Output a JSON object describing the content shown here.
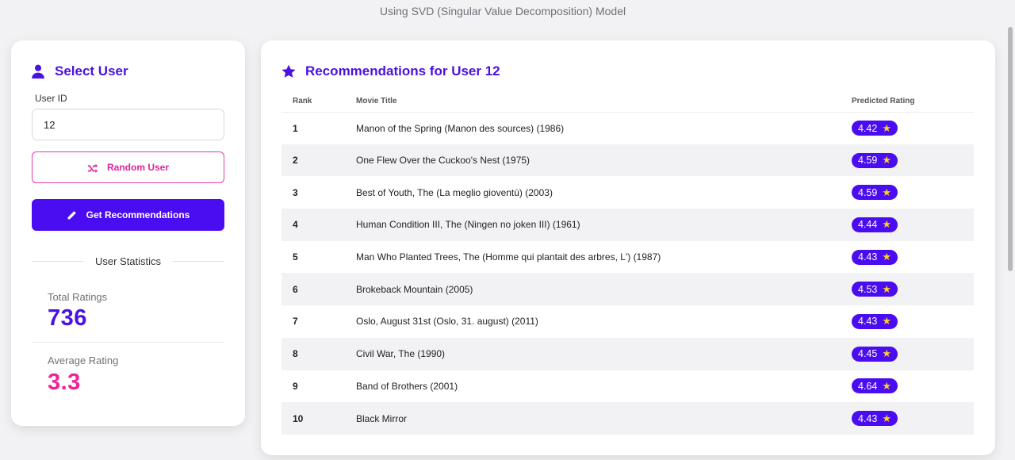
{
  "header": {
    "subtitle": "Using SVD (Singular Value Decomposition) Model"
  },
  "colors": {
    "primary": "#4a12e0",
    "accent_pink": "#f0229a",
    "star": "#ffd21a"
  },
  "left": {
    "title": "Select User",
    "title_icon": "user-icon",
    "user_id_label": "User ID",
    "user_id_value": "12",
    "random_button": "Random User",
    "random_icon": "shuffle-icon",
    "get_button": "Get Recommendations",
    "get_icon": "pencil-icon",
    "stats_heading": "User Statistics",
    "stats": {
      "total_label": "Total Ratings",
      "total_value": "736",
      "avg_label": "Average Rating",
      "avg_value": "3.3"
    }
  },
  "right": {
    "title": "Recommendations for User 12",
    "title_icon": "star-icon",
    "columns": [
      "Rank",
      "Movie Title",
      "Predicted Rating"
    ],
    "rows": [
      {
        "rank": "1",
        "title": "Manon of the Spring (Manon des sources) (1986)",
        "rating": "4.42"
      },
      {
        "rank": "2",
        "title": "One Flew Over the Cuckoo's Nest (1975)",
        "rating": "4.59"
      },
      {
        "rank": "3",
        "title": "Best of Youth, The (La meglio gioventù) (2003)",
        "rating": "4.59"
      },
      {
        "rank": "4",
        "title": "Human Condition III, The (Ningen no joken III) (1961)",
        "rating": "4.44"
      },
      {
        "rank": "5",
        "title": "Man Who Planted Trees, The (Homme qui plantait des arbres, L') (1987)",
        "rating": "4.43"
      },
      {
        "rank": "6",
        "title": "Brokeback Mountain (2005)",
        "rating": "4.53"
      },
      {
        "rank": "7",
        "title": "Oslo, August 31st (Oslo, 31. august) (2011)",
        "rating": "4.43"
      },
      {
        "rank": "8",
        "title": "Civil War, The (1990)",
        "rating": "4.45"
      },
      {
        "rank": "9",
        "title": "Band of Brothers (2001)",
        "rating": "4.64"
      },
      {
        "rank": "10",
        "title": "Black Mirror",
        "rating": "4.43"
      }
    ]
  }
}
